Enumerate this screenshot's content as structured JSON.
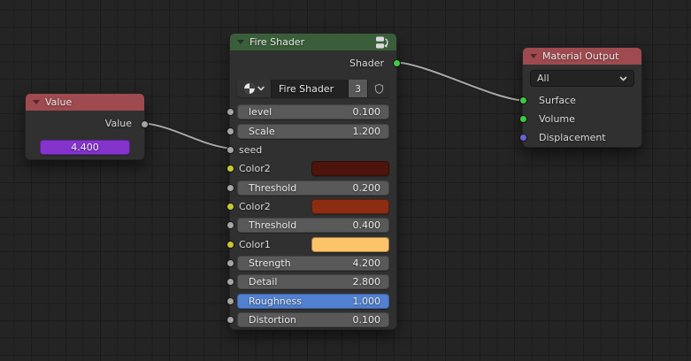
{
  "editor": {
    "background": "#242424",
    "grid_line": "#1b1b1b"
  },
  "colors": {
    "node_body": "#303030",
    "header_red": "#9e4a4e",
    "header_green": "#3a5e3a",
    "slider_gray": "#595959",
    "slider_full_blue": "#5181d0",
    "value_purple": "#8433cc",
    "socket_gray": "#a5a5a5",
    "socket_yellow": "#c8c832",
    "socket_green": "#3fca3f",
    "socket_blue": "#6a63d6",
    "link": "#a8a8a8"
  },
  "value_node": {
    "title": "Value",
    "output_label": "Value",
    "value": "4.400"
  },
  "fire_shader_node": {
    "title": "Fire Shader",
    "output_label": "Shader",
    "material_name": "Fire Shader",
    "users_count": "3",
    "rows": [
      {
        "type": "slider",
        "label": "level",
        "value": "0.100"
      },
      {
        "type": "slider",
        "label": "Scale",
        "value": "1.200"
      },
      {
        "type": "input",
        "label": "seed"
      },
      {
        "type": "color",
        "label": "Color2",
        "swatch": "#4d140c"
      },
      {
        "type": "slider",
        "label": "Threshold",
        "value": "0.200"
      },
      {
        "type": "color",
        "label": "Color2",
        "swatch": "#8c2d13"
      },
      {
        "type": "slider",
        "label": "Threshold",
        "value": "0.400"
      },
      {
        "type": "color",
        "label": "Color1",
        "swatch": "#fcc369"
      },
      {
        "type": "slider",
        "label": "Strength",
        "value": "4.200"
      },
      {
        "type": "slider",
        "label": "Detail",
        "value": "2.800"
      },
      {
        "type": "slider_full",
        "label": "Roughness",
        "value": "1.000"
      },
      {
        "type": "slider",
        "label": "Distortion",
        "value": "0.100"
      }
    ]
  },
  "material_output_node": {
    "title": "Material Output",
    "target_dropdown": "All",
    "inputs": [
      {
        "label": "Surface"
      },
      {
        "label": "Volume"
      },
      {
        "label": "Displacement"
      }
    ]
  }
}
